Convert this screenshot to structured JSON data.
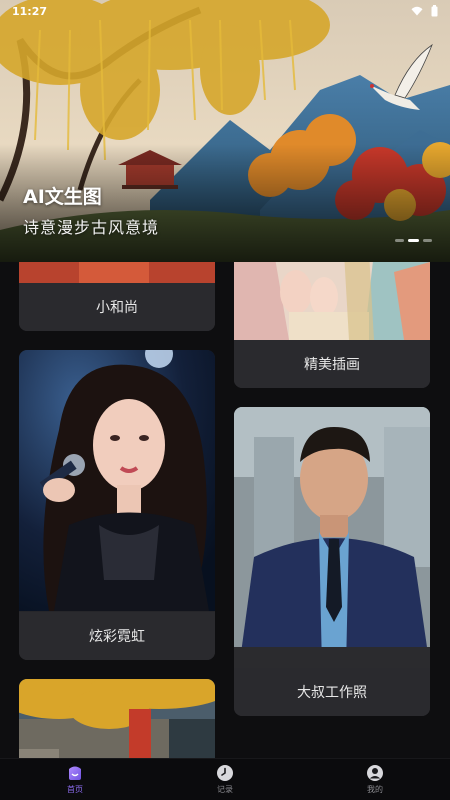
{
  "status_bar": {
    "time": "11:27",
    "icons": [
      "wifi-icon",
      "battery-icon"
    ]
  },
  "banner": {
    "title": "AI文生图",
    "subtitle": "诗意漫步古风意境",
    "slides": 3,
    "active_slide": 2
  },
  "gallery": {
    "cards": [
      {
        "label": "小和尚"
      },
      {
        "label": "精美插画"
      },
      {
        "label": "炫彩霓虹"
      },
      {
        "label": "大叔工作照"
      }
    ]
  },
  "nav": {
    "items": [
      {
        "label": "首页",
        "icon": "home-icon",
        "active": true
      },
      {
        "label": "记录",
        "icon": "clock-icon",
        "active": false
      },
      {
        "label": "我的",
        "icon": "profile-icon",
        "active": false
      }
    ]
  },
  "colors": {
    "accent": "#8c6cf0",
    "background": "#0e0e10",
    "card": "#2a2a2e"
  }
}
